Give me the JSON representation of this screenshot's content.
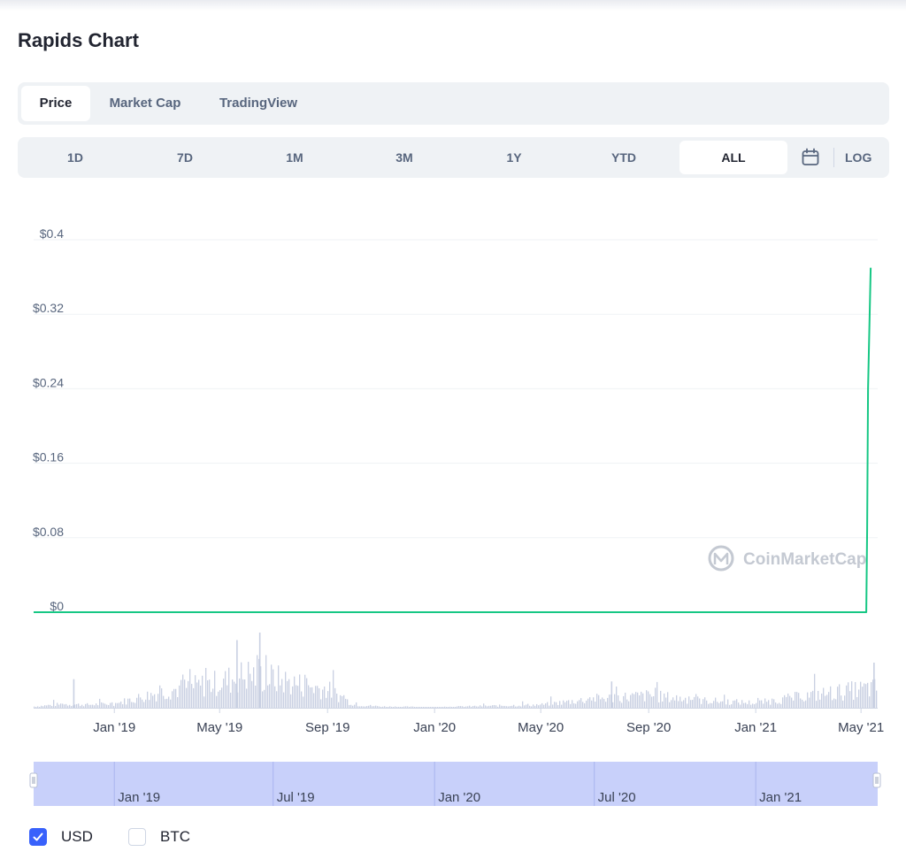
{
  "title": "Rapids Chart",
  "tabs": [
    {
      "label": "Price",
      "active": true
    },
    {
      "label": "Market Cap",
      "active": false
    },
    {
      "label": "TradingView",
      "active": false
    }
  ],
  "ranges": [
    {
      "label": "1D",
      "active": false
    },
    {
      "label": "7D",
      "active": false
    },
    {
      "label": "1M",
      "active": false
    },
    {
      "label": "3M",
      "active": false
    },
    {
      "label": "1Y",
      "active": false
    },
    {
      "label": "YTD",
      "active": false
    },
    {
      "label": "ALL",
      "active": true
    }
  ],
  "log_label": "LOG",
  "watermark": "CoinMarketCap",
  "colors": {
    "line": "#16c784",
    "volume": "#c9d0e2",
    "accent": "#3861fb",
    "navigator": "#c8d0fa"
  },
  "chart_data": {
    "type": "line",
    "ylim": [
      0,
      0.4
    ],
    "y_ticks": [
      "$0.4",
      "$0.32",
      "$0.24",
      "$0.16",
      "$0.08",
      "$0"
    ],
    "x_ticks": [
      "Jan '19",
      "May '19",
      "Sep '19",
      "Jan '20",
      "May '20",
      "Sep '20",
      "Jan '21",
      "May '21"
    ],
    "x_range": [
      "2018-10-01",
      "2021-05-20"
    ],
    "grid": true,
    "series": [
      {
        "values": [
          {
            "x": "2018-10-01",
            "y": 0.0
          },
          {
            "x": "2019-06-01",
            "y": 0.0
          },
          {
            "x": "2020-06-01",
            "y": 0.0
          },
          {
            "x": "2021-05-07",
            "y": 0.0
          },
          {
            "x": "2021-05-08",
            "y": 0.09
          },
          {
            "x": "2021-05-09",
            "y": 0.24
          },
          {
            "x": "2021-05-12",
            "y": 0.37
          }
        ]
      }
    ],
    "volume_level": [
      {
        "x": "2018-10-01",
        "v": 0.02
      },
      {
        "x": "2018-11-01",
        "v": 0.06
      },
      {
        "x": "2018-12-01",
        "v": 0.05
      },
      {
        "x": "2019-01-01",
        "v": 0.07
      },
      {
        "x": "2019-02-01",
        "v": 0.18
      },
      {
        "x": "2019-03-01",
        "v": 0.28
      },
      {
        "x": "2019-04-01",
        "v": 0.35
      },
      {
        "x": "2019-05-01",
        "v": 0.42
      },
      {
        "x": "2019-06-01",
        "v": 0.55
      },
      {
        "x": "2019-07-01",
        "v": 0.48
      },
      {
        "x": "2019-08-01",
        "v": 0.38
      },
      {
        "x": "2019-09-01",
        "v": 0.3
      },
      {
        "x": "2019-10-01",
        "v": 0.05
      },
      {
        "x": "2019-11-01",
        "v": 0.02
      },
      {
        "x": "2020-01-01",
        "v": 0.01
      },
      {
        "x": "2020-05-01",
        "v": 0.05
      },
      {
        "x": "2020-07-01",
        "v": 0.15
      },
      {
        "x": "2020-09-01",
        "v": 0.2
      },
      {
        "x": "2020-11-01",
        "v": 0.12
      },
      {
        "x": "2021-01-01",
        "v": 0.08
      },
      {
        "x": "2021-03-01",
        "v": 0.2
      },
      {
        "x": "2021-05-10",
        "v": 0.32
      }
    ],
    "volume_peaks": [
      {
        "x": "2019-05-20",
        "v": 0.9
      },
      {
        "x": "2019-06-15",
        "v": 1.0
      },
      {
        "x": "2018-11-15",
        "v": 0.38
      },
      {
        "x": "2020-07-20",
        "v": 0.35
      },
      {
        "x": "2021-05-15",
        "v": 0.6
      }
    ],
    "navigator_ticks": [
      "Jan '19",
      "Jul '19",
      "Jan '20",
      "Jul '20",
      "Jan '21"
    ]
  },
  "currency_toggles": [
    {
      "label": "USD",
      "checked": true
    },
    {
      "label": "BTC",
      "checked": false
    }
  ]
}
